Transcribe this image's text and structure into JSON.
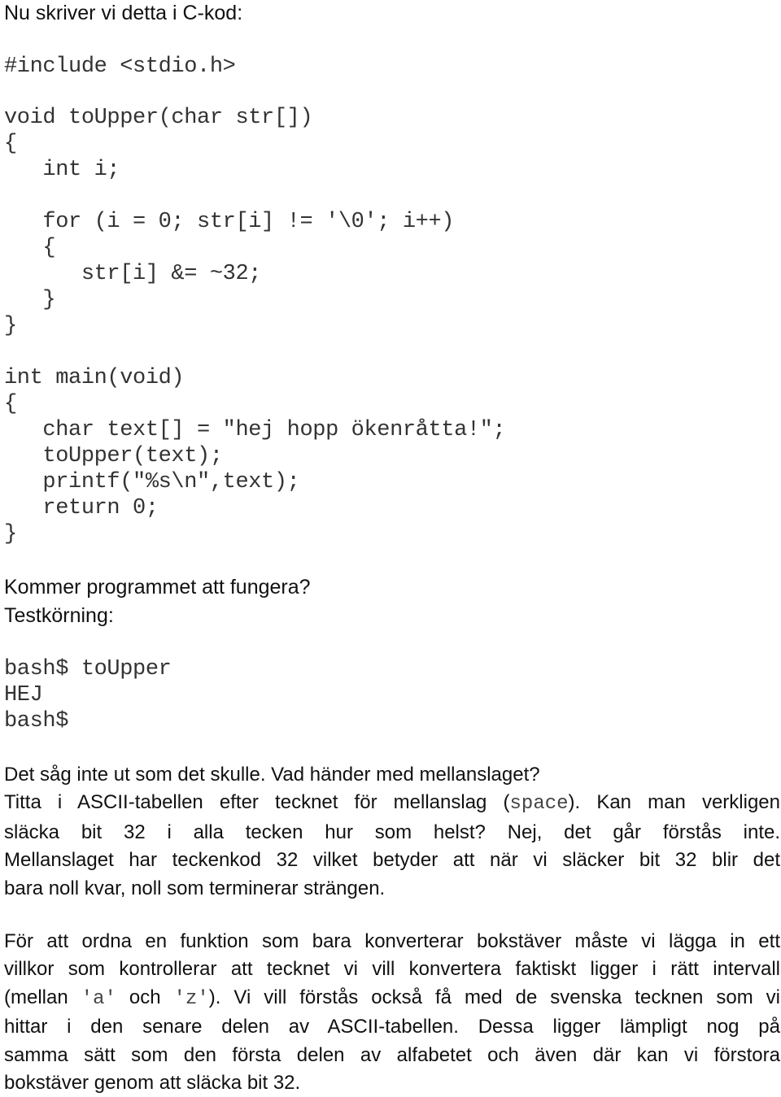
{
  "intro": "Nu skriver vi detta i C-kod:",
  "code": {
    "lines": [
      "#include <stdio.h>",
      "",
      "void toUpper(char str[])",
      "{",
      "   int i;",
      "",
      "   for (i = 0; str[i] != '\\0'; i++)",
      "   {",
      "      str[i] &= ~32;",
      "   }",
      "}",
      "",
      "int main(void)",
      "{",
      "   char text[] = \"hej hopp ökenråtta!\";",
      "   toUpper(text);",
      "   printf(\"%s\\n\",text);",
      "   return 0;",
      "}"
    ]
  },
  "question": "Kommer programmet att fungera?",
  "testrun_label": "Testkörning:",
  "terminal": {
    "lines": [
      "bash$ toUpper",
      "HEJ",
      "bash$"
    ]
  },
  "paragraph1": {
    "lines": [
      "Det såg inte ut som det skulle. Vad händer med mellanslaget?",
      "Titta i ASCII-tabellen efter tecknet för mellanslag (",
      "space",
      "). Kan man verkligen",
      "släcka bit 32 i alla tecken hur som helst? Nej, det går förstås inte.",
      "Mellanslaget har teckenkod 32 vilket betyder att när vi släcker bit 32 blir det",
      "bara noll kvar, noll som terminerar strängen."
    ]
  },
  "paragraph2": {
    "line1": "För att ordna en funktion som bara konverterar bokstäver måste vi lägga in ett",
    "line2": "villkor som kontrollerar att tecknet vi vill konvertera faktiskt ligger i rätt intervall",
    "line3_a": "(mellan ",
    "line3_code1": "'a'",
    "line3_b": " och ",
    "line3_code2": "'z'",
    "line3_c": "). Vi vill förstås också få med de svenska tecknen som vi",
    "line4": "hittar i den senare delen av ASCII-tabellen. Dessa ligger lämpligt nog på",
    "line5": "samma sätt som den första delen av alfabetet och även där kan vi förstora",
    "line6": "bokstäver genom att släcka bit 32."
  }
}
